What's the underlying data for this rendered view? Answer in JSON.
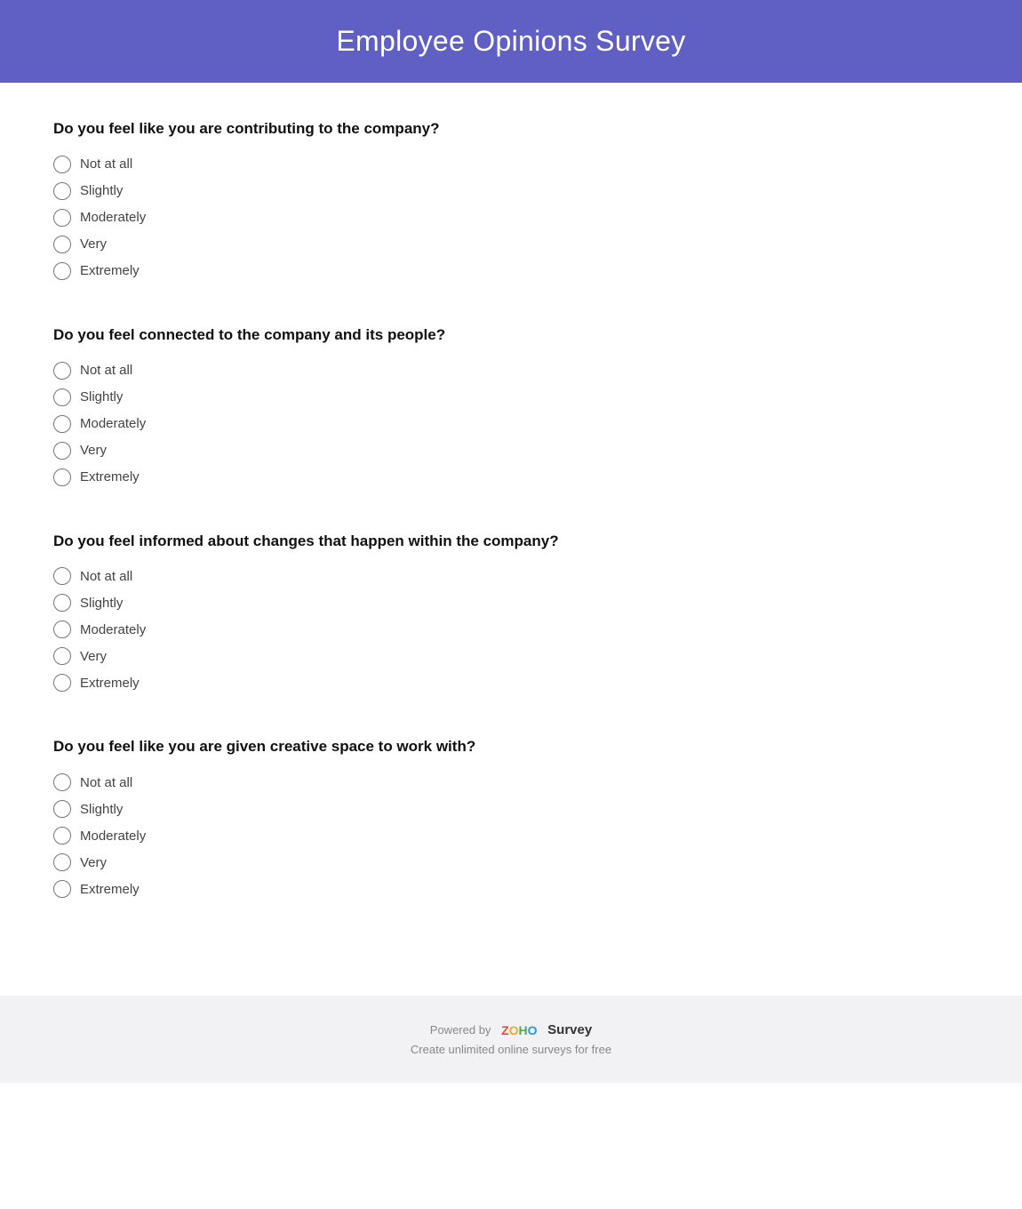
{
  "header": {
    "title": "Employee Opinions Survey"
  },
  "questions": [
    {
      "id": "q1",
      "text": "Do you feel like you are contributing to the company?",
      "options": [
        "Not at all",
        "Slightly",
        "Moderately",
        "Very",
        "Extremely"
      ]
    },
    {
      "id": "q2",
      "text": "Do you feel connected to the company and its people?",
      "options": [
        "Not at all",
        "Slightly",
        "Moderately",
        "Very",
        "Extremely"
      ]
    },
    {
      "id": "q3",
      "text": "Do you feel informed about changes that happen within the company?",
      "options": [
        "Not at all",
        "Slightly",
        "Moderately",
        "Very",
        "Extremely"
      ]
    },
    {
      "id": "q4",
      "text": "Do you feel like you are given creative space to work with?",
      "options": [
        "Not at all",
        "Slightly",
        "Moderately",
        "Very",
        "Extremely"
      ]
    }
  ],
  "footer": {
    "powered_by": "Powered by",
    "zoho_letters": [
      "Z",
      "O",
      "H",
      "O"
    ],
    "zoho_brand": "Survey",
    "tagline": "Create unlimited online surveys for free"
  }
}
